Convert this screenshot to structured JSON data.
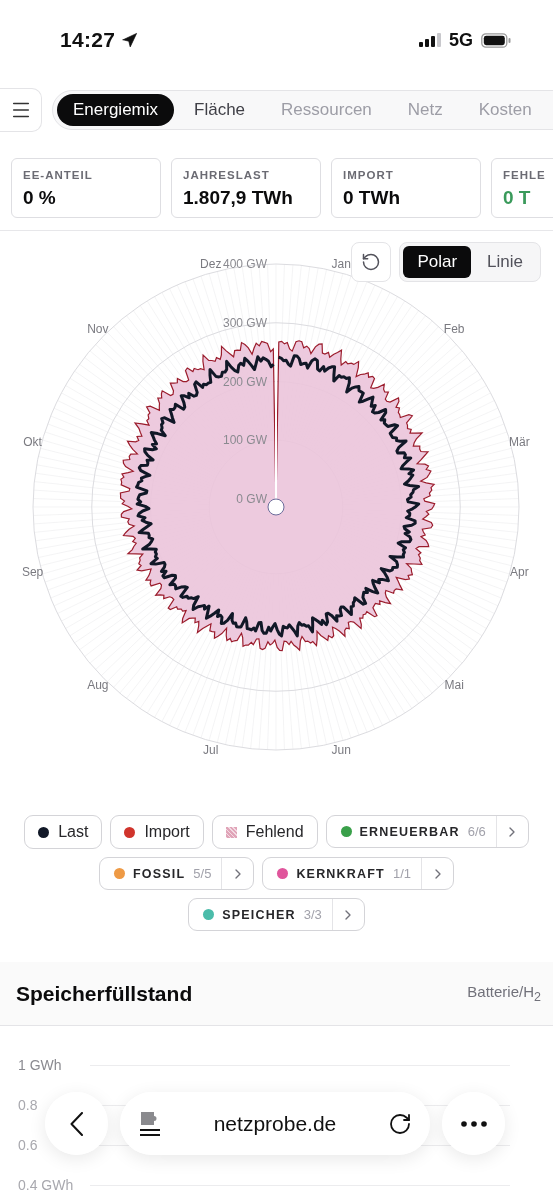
{
  "status_bar": {
    "time": "14:27",
    "network": "5G"
  },
  "tabs": [
    {
      "label": "Energiemix",
      "selected": true,
      "disabled": false
    },
    {
      "label": "Fläche",
      "selected": false,
      "disabled": false
    },
    {
      "label": "Ressourcen",
      "selected": false,
      "disabled": true
    },
    {
      "label": "Netz",
      "selected": false,
      "disabled": true
    },
    {
      "label": "Kosten",
      "selected": false,
      "disabled": true
    }
  ],
  "stats": [
    {
      "label": "EE-ANTEIL",
      "value": "0 %",
      "positive": false
    },
    {
      "label": "JAHRESLAST",
      "value": "1.807,9 TWh",
      "positive": false
    },
    {
      "label": "IMPORT",
      "value": "0 TWh",
      "positive": false
    },
    {
      "label": "FEHLE",
      "value": "0 T",
      "positive": true
    }
  ],
  "view_toggle": [
    {
      "label": "Polar",
      "selected": true
    },
    {
      "label": "Linie",
      "selected": false
    }
  ],
  "polar_chart": {
    "month_labels": [
      "Jan",
      "Feb",
      "Mär",
      "Apr",
      "Mai",
      "Jun",
      "Jul",
      "Aug",
      "Sep",
      "Okt",
      "Nov",
      "Dez"
    ],
    "ring_labels": [
      "400 GW",
      "300 GW",
      "200 GW",
      "100 GW",
      "0 GW"
    ]
  },
  "legend": [
    {
      "label": "Last",
      "kind": "dot",
      "color": "#111827"
    },
    {
      "label": "Import",
      "kind": "dot",
      "color": "#d0342c"
    },
    {
      "label": "Fehlend",
      "kind": "hatch",
      "color": "#e0a4b8"
    },
    {
      "label": "ERNEUERBAR",
      "kind": "group",
      "color": "#3aa04a",
      "count": "6/6"
    },
    {
      "label": "FOSSIL",
      "kind": "group",
      "color": "#ee9a45",
      "count": "5/5"
    },
    {
      "label": "KERNKRAFT",
      "kind": "group",
      "color": "#e0559c",
      "count": "1/1"
    },
    {
      "label": "SPEICHER",
      "kind": "group",
      "color": "#4bbcaa",
      "count": "3/3"
    }
  ],
  "storage": {
    "title": "Speicherfüllstand",
    "subtitle": "Batterie/H$_{2}$",
    "axis_labels": [
      "1 GWh",
      "0.8",
      "0.6",
      "0.4 GWh"
    ]
  },
  "browser": {
    "url": "netzprobe.de"
  }
}
